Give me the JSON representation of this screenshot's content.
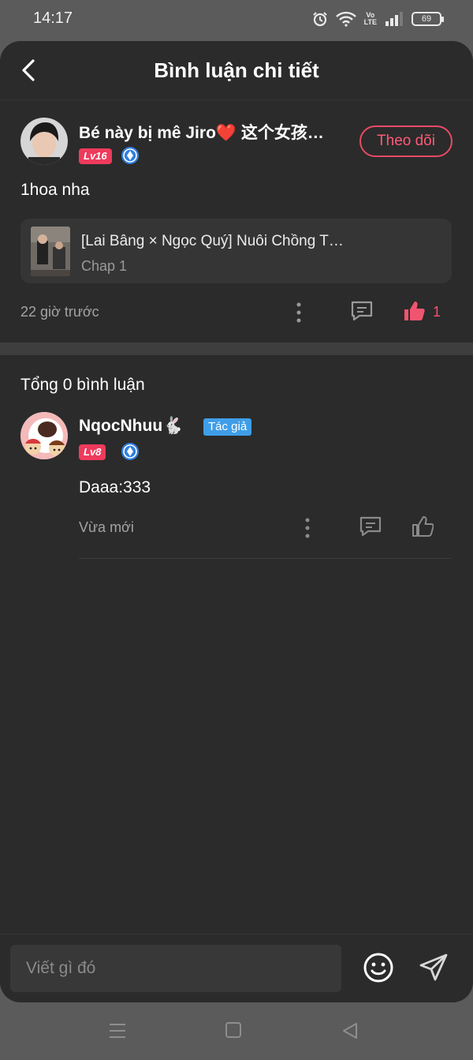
{
  "status": {
    "time": "14:17",
    "battery": "69",
    "network": "Vo\nLTE"
  },
  "header": {
    "title": "Bình luận chi tiết"
  },
  "post": {
    "username": "Bé này bị mê Jiro❤️ 这个女孩…",
    "level": "Lv16",
    "follow_label": "Theo dõi",
    "text": "1hoa nha",
    "manga": {
      "title": "[Lai Bâng × Ngọc Quý] Nuôi Chồng T…",
      "chapter": "Chap 1"
    },
    "time": "22 giờ trước",
    "likes": "1"
  },
  "comments": {
    "total_label": "Tổng 0 bình luận",
    "items": [
      {
        "username": "NqocNhuu🐇",
        "level": "Lv8",
        "author_tag": "Tác giả",
        "text": "Daaa:333",
        "time": "Vừa mới"
      }
    ]
  },
  "input": {
    "placeholder": "Viết gì đó"
  },
  "colors": {
    "accent": "#ee3b5c",
    "author_tag": "#3f9ee8",
    "background": "#2b2b2b"
  },
  "icons": [
    "back-icon",
    "shield-icon",
    "more-icon",
    "comment-icon",
    "thumbs-up-icon",
    "emoji-icon",
    "send-icon",
    "menu-nav-icon",
    "home-nav-icon",
    "back-nav-icon"
  ]
}
